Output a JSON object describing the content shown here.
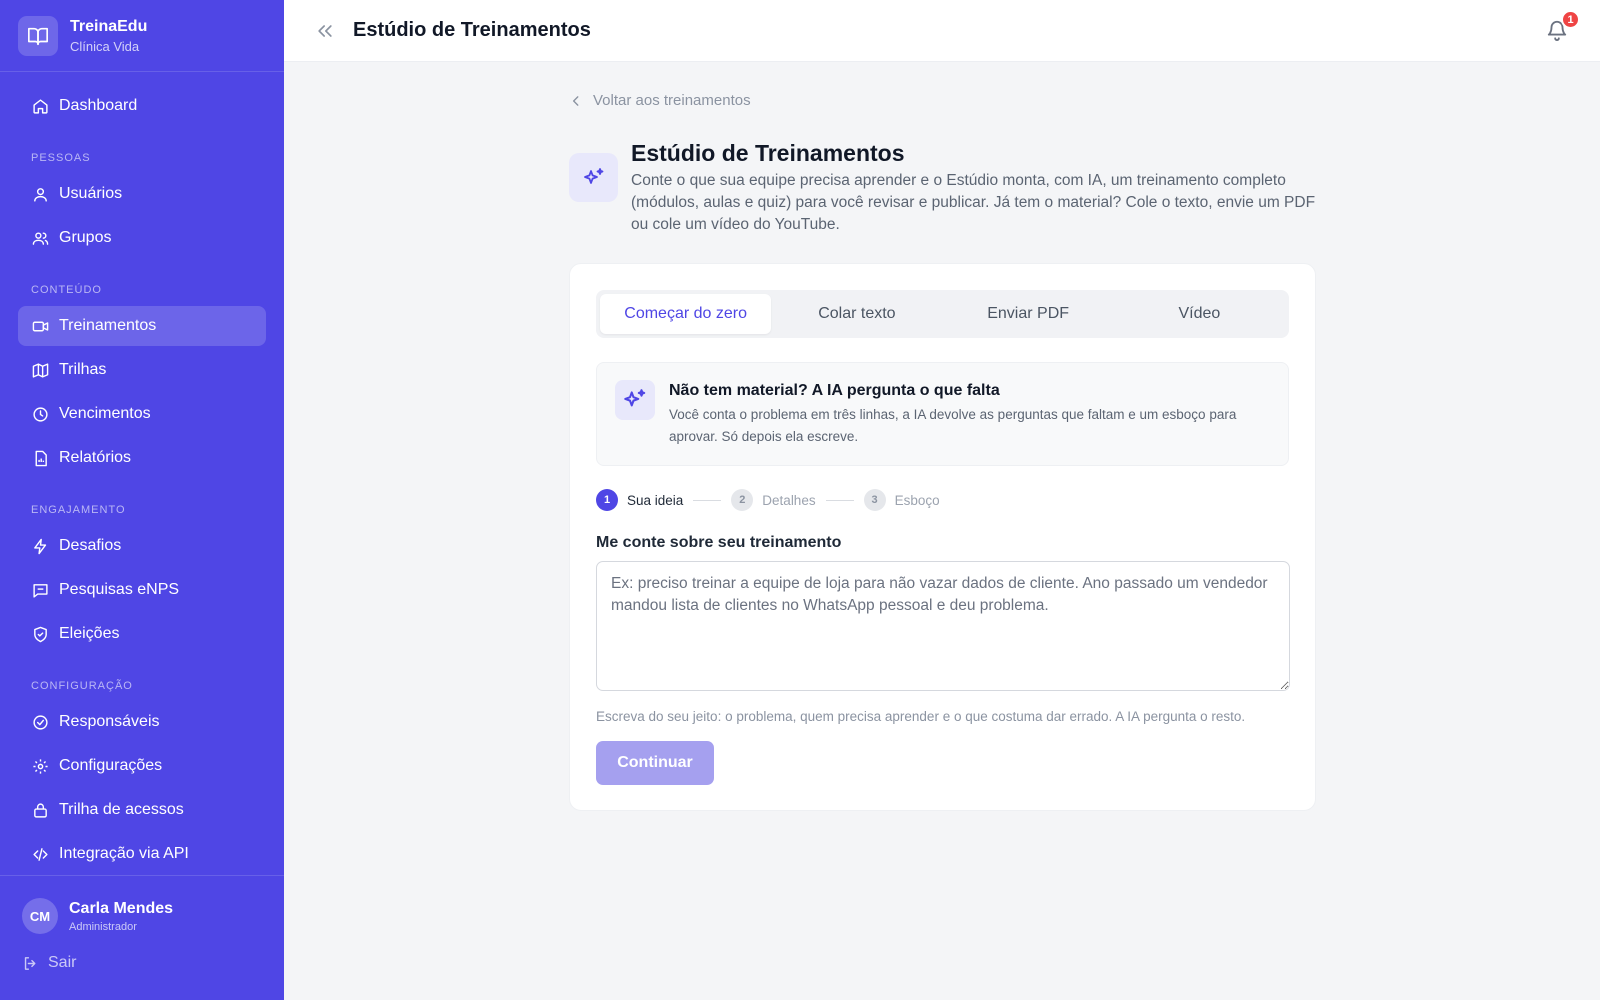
{
  "brand": {
    "name": "TreinaEdu",
    "subtitle": "Clínica Vida",
    "icon": "book-open-icon"
  },
  "nav": {
    "dashboard": "Dashboard",
    "sections": {
      "pessoas": "PESSOAS",
      "conteudo": "CONTEÚDO",
      "engajamento": "ENGAJAMENTO",
      "configuracao": "CONFIGURAÇÃO"
    },
    "items": {
      "usuarios": "Usuários",
      "grupos": "Grupos",
      "treinamentos": "Treinamentos",
      "trilhas": "Trilhas",
      "vencimentos": "Vencimentos",
      "relatorios": "Relatórios",
      "desafios": "Desafios",
      "pesquisas": "Pesquisas eNPS",
      "eleicoes": "Eleições",
      "responsaveis": "Responsáveis",
      "configuracoes": "Configurações",
      "trilha_acessos": "Trilha de acessos",
      "api": "Integração via API"
    },
    "active": "treinamentos"
  },
  "user": {
    "initials": "CM",
    "name": "Carla Mendes",
    "role": "Administrador",
    "logout": "Sair"
  },
  "topbar": {
    "title": "Estúdio de Treinamentos",
    "notifications": "1"
  },
  "back_link": "Voltar aos treinamentos",
  "hero": {
    "title": "Estúdio de Treinamentos",
    "description": "Conte o que sua equipe precisa aprender e o Estúdio monta, com IA, um treinamento completo (módulos, aulas e quiz) para você revisar e publicar. Já tem o material? Cole o texto, envie um PDF ou cole um vídeo do YouTube."
  },
  "tabs": [
    "Começar do zero",
    "Colar texto",
    "Enviar PDF",
    "Vídeo"
  ],
  "active_tab": "Começar do zero",
  "info": {
    "title": "Não tem material? A IA pergunta o que falta",
    "description": "Você conta o problema em três linhas, a IA devolve as perguntas que faltam e um esboço para aprovar. Só depois ela escreve."
  },
  "steps": [
    {
      "num": "1",
      "label": "Sua ideia",
      "active": true
    },
    {
      "num": "2",
      "label": "Detalhes",
      "active": false
    },
    {
      "num": "3",
      "label": "Esboço",
      "active": false
    }
  ],
  "form": {
    "label": "Me conte sobre seu treinamento",
    "value": "",
    "placeholder": "Ex: preciso treinar a equipe de loja para não vazar dados de cliente. Ano passado um vendedor mandou lista de clientes no WhatsApp pessoal e deu problema.",
    "hint": "Escreva do seu jeito: o problema, quem precisa aprender e o que costuma dar errado. A IA pergunta o resto.",
    "submit": "Continuar"
  },
  "colors": {
    "primary": "#4f46e5",
    "primary_disabled": "#a5a0ef",
    "badge": "#ef4444"
  }
}
